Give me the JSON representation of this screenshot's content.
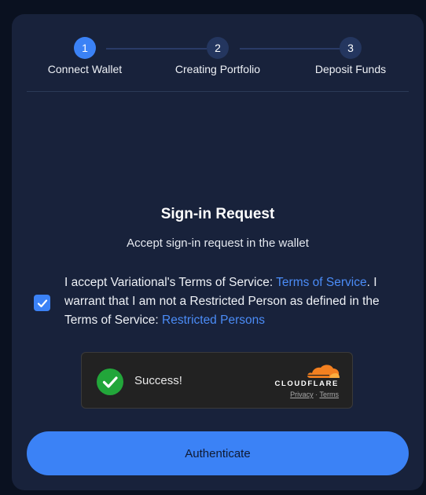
{
  "stepper": {
    "steps": [
      {
        "number": "1",
        "label": "Connect Wallet",
        "state": "active"
      },
      {
        "number": "2",
        "label": "Creating Portfolio",
        "state": "inactive"
      },
      {
        "number": "3",
        "label": "Deposit Funds",
        "state": "inactive"
      }
    ]
  },
  "signin": {
    "title": "Sign-in Request",
    "subtitle": "Accept sign-in request in the wallet"
  },
  "terms": {
    "checked": true,
    "text_1": "I accept Variational's Terms of Service: ",
    "link_1": "Terms of Service",
    "text_2": ". I warrant that I am not a Restricted Person as defined in the Terms of Service: ",
    "link_2": "Restricted Persons"
  },
  "captcha": {
    "status": "Success!",
    "brand": "CLOUDFLARE",
    "privacy": "Privacy",
    "separator": "·",
    "terms": "Terms"
  },
  "actions": {
    "authenticate": "Authenticate"
  },
  "colors": {
    "background": "#0a1120",
    "panel": "#18223b",
    "accent": "#3b82f6",
    "link": "#4b8cf7",
    "success": "#22a63a",
    "cloudflare_orange": "#f38020"
  }
}
